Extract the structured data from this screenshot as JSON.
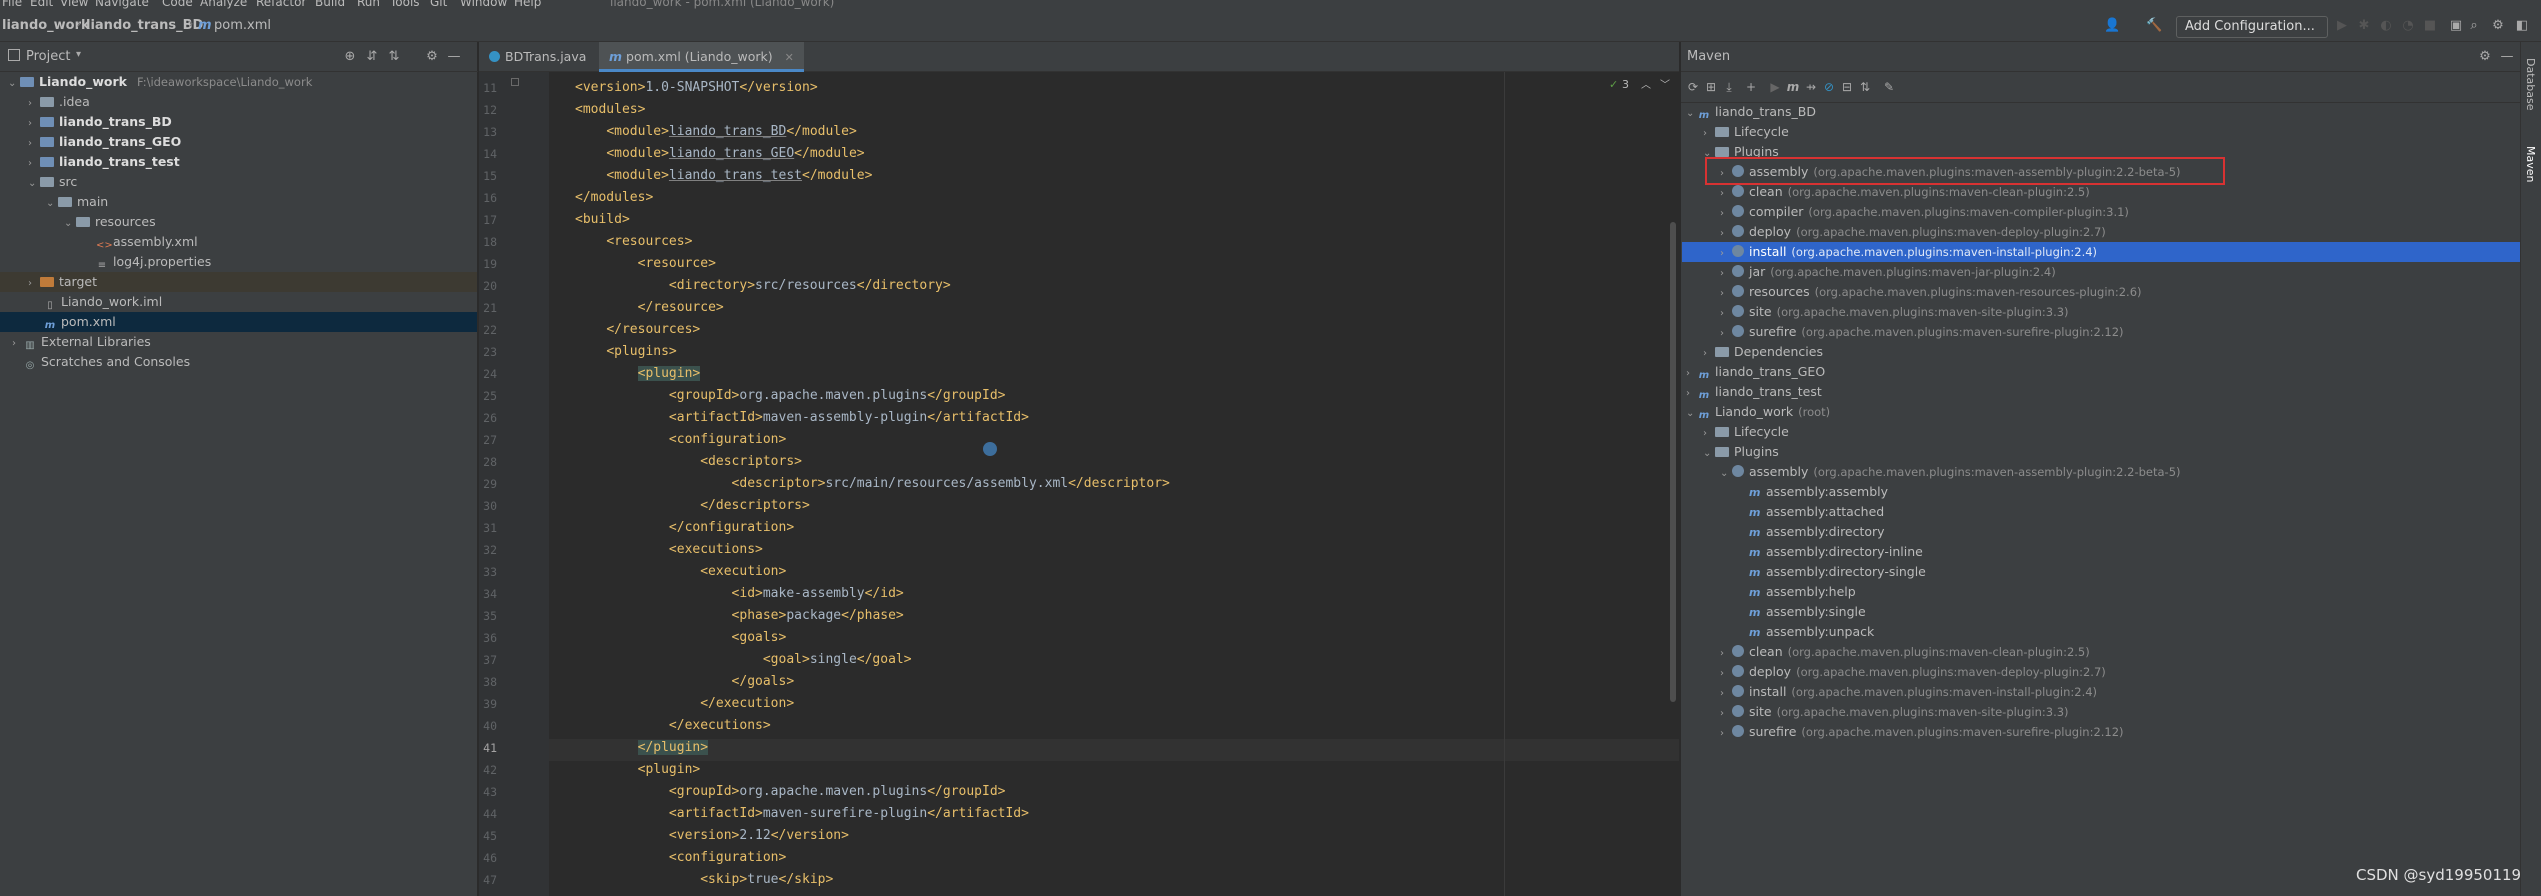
{
  "window": {
    "title": "liando_work - pom.xml (Liando_work)"
  },
  "menu": [
    "File",
    "Edit",
    "View",
    "Navigate",
    "Code",
    "Analyze",
    "Refactor",
    "Build",
    "Run",
    "Tools",
    "Git",
    "Window",
    "Help"
  ],
  "breadcrumb": {
    "project": "liando_work",
    "module": "liando_trans_BD",
    "file": "pom.xml"
  },
  "toolbar": {
    "run_config": "Add Configuration..."
  },
  "project": {
    "title": "Project",
    "root_name": "Liando_work",
    "root_path": "F:\\ideaworkspace\\Liando_work",
    "items": [
      {
        "label": ".idea"
      },
      {
        "label": "liando_trans_BD"
      },
      {
        "label": "liando_trans_GEO"
      },
      {
        "label": "liando_trans_test"
      },
      {
        "label": "src"
      },
      {
        "label": "main"
      },
      {
        "label": "resources"
      },
      {
        "label": "assembly.xml"
      },
      {
        "label": "log4j.properties"
      },
      {
        "label": "target"
      },
      {
        "label": "Liando_work.iml"
      },
      {
        "label": "pom.xml"
      },
      {
        "label": "External Libraries"
      },
      {
        "label": "Scratches and Consoles"
      }
    ]
  },
  "editor": {
    "tabs": [
      {
        "label": "BDTrans.java"
      },
      {
        "label": "pom.xml (Liando_work)"
      }
    ],
    "inspection_count": "3",
    "line_numbers": [
      "11",
      "12",
      "13",
      "14",
      "15",
      "16",
      "17",
      "18",
      "19",
      "20",
      "21",
      "22",
      "23",
      "24",
      "25",
      "26",
      "27",
      "28",
      "29",
      "30",
      "31",
      "32",
      "33",
      "34",
      "35",
      "36",
      "37",
      "38",
      "39",
      "40",
      "41",
      "42",
      "43",
      "44",
      "45",
      "46",
      "47"
    ],
    "lines": [
      "<version>1.0-SNAPSHOT</version>",
      "<modules>",
      "    <module>liando_trans_BD</module>",
      "    <module>liando_trans_GEO</module>",
      "    <module>liando_trans_test</module>",
      "</modules>",
      "<build>",
      "    <resources>",
      "        <resource>",
      "            <directory>src/resources</directory>",
      "        </resource>",
      "    </resources>",
      "    <plugins>",
      "        <plugin>",
      "            <groupId>org.apache.maven.plugins</groupId>",
      "            <artifactId>maven-assembly-plugin</artifactId>",
      "            <configuration>",
      "                <descriptors>",
      "                    <descriptor>src/main/resources/assembly.xml</descriptor>",
      "                </descriptors>",
      "            </configuration>",
      "            <executions>",
      "                <execution>",
      "                    <id>make-assembly</id>",
      "                    <phase>package</phase>",
      "                    <goals>",
      "                        <goal>single</goal>",
      "                    </goals>",
      "                </execution>",
      "            </executions>",
      "        </plugin>",
      "        <plugin>",
      "            <groupId>org.apache.maven.plugins</groupId>",
      "            <artifactId>maven-surefire-plugin</artifactId>",
      "            <version>2.12</version>",
      "            <configuration>",
      "                <skip>true</skip>"
    ]
  },
  "maven": {
    "title": "Maven",
    "tree": [
      {
        "label": "liando_trans_BD",
        "detail": ""
      },
      {
        "label": "Lifecycle",
        "detail": ""
      },
      {
        "label": "Plugins",
        "detail": ""
      },
      {
        "label": "assembly",
        "detail": "(org.apache.maven.plugins:maven-assembly-plugin:2.2-beta-5)"
      },
      {
        "label": "clean",
        "detail": "(org.apache.maven.plugins:maven-clean-plugin:2.5)"
      },
      {
        "label": "compiler",
        "detail": "(org.apache.maven.plugins:maven-compiler-plugin:3.1)"
      },
      {
        "label": "deploy",
        "detail": "(org.apache.maven.plugins:maven-deploy-plugin:2.7)"
      },
      {
        "label": "install",
        "detail": "(org.apache.maven.plugins:maven-install-plugin:2.4)"
      },
      {
        "label": "jar",
        "detail": "(org.apache.maven.plugins:maven-jar-plugin:2.4)"
      },
      {
        "label": "resources",
        "detail": "(org.apache.maven.plugins:maven-resources-plugin:2.6)"
      },
      {
        "label": "site",
        "detail": "(org.apache.maven.plugins:maven-site-plugin:3.3)"
      },
      {
        "label": "surefire",
        "detail": "(org.apache.maven.plugins:maven-surefire-plugin:2.12)"
      },
      {
        "label": "Dependencies",
        "detail": ""
      },
      {
        "label": "liando_trans_GEO",
        "detail": ""
      },
      {
        "label": "liando_trans_test",
        "detail": ""
      },
      {
        "label": "Liando_work",
        "detail": "(root)"
      },
      {
        "label": "Lifecycle",
        "detail": ""
      },
      {
        "label": "Plugins",
        "detail": ""
      },
      {
        "label": "assembly",
        "detail": "(org.apache.maven.plugins:maven-assembly-plugin:2.2-beta-5)"
      },
      {
        "label": "assembly:assembly",
        "detail": ""
      },
      {
        "label": "assembly:attached",
        "detail": ""
      },
      {
        "label": "assembly:directory",
        "detail": ""
      },
      {
        "label": "assembly:directory-inline",
        "detail": ""
      },
      {
        "label": "assembly:directory-single",
        "detail": ""
      },
      {
        "label": "assembly:help",
        "detail": ""
      },
      {
        "label": "assembly:single",
        "detail": ""
      },
      {
        "label": "assembly:unpack",
        "detail": ""
      },
      {
        "label": "clean",
        "detail": "(org.apache.maven.plugins:maven-clean-plugin:2.5)"
      },
      {
        "label": "deploy",
        "detail": "(org.apache.maven.plugins:maven-deploy-plugin:2.7)"
      },
      {
        "label": "install",
        "detail": "(org.apache.maven.plugins:maven-install-plugin:2.4)"
      },
      {
        "label": "site",
        "detail": "(org.apache.maven.plugins:maven-site-plugin:3.3)"
      },
      {
        "label": "surefire",
        "detail": "(org.apache.maven.plugins:maven-surefire-plugin:2.12)"
      }
    ]
  },
  "side_tabs": {
    "database": "Database",
    "maven": "Maven"
  },
  "watermark": "CSDN @syd19950119",
  "colors": {
    "selection": "#2f65ca",
    "highlight_box": "#d83232",
    "tag": "#e8bf6a",
    "text": "#a9b7c6"
  }
}
